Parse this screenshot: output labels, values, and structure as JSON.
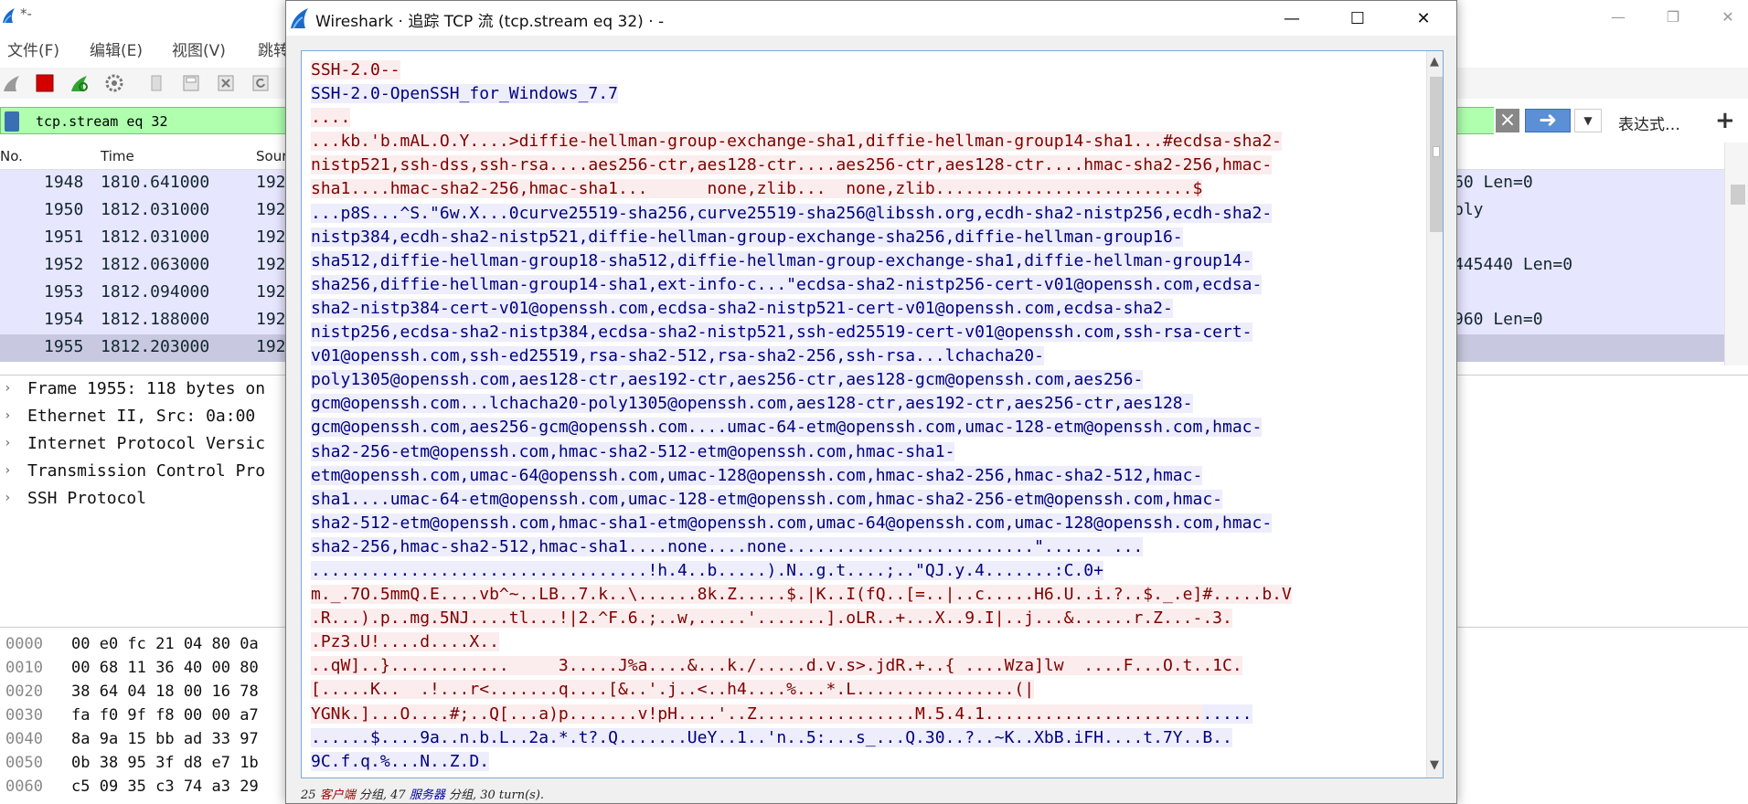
{
  "main_window": {
    "title": "*-",
    "menu": [
      "文件(F)",
      "编辑(E)",
      "视图(V)",
      "跳转"
    ],
    "filter": {
      "text": "tcp.stream eq 32",
      "expression_label": "表达式…",
      "plus": "+"
    },
    "packet_list": {
      "headers": [
        "No.",
        "Time",
        "Sour"
      ],
      "rows": [
        {
          "no": "1948",
          "time": "1810.641000",
          "src": "192",
          "info": "60 Len=0"
        },
        {
          "no": "1950",
          "time": "1812.031000",
          "src": "192",
          "info": "ply"
        },
        {
          "no": "1951",
          "time": "1812.031000",
          "src": "192",
          "info": ""
        },
        {
          "no": "1952",
          "time": "1812.063000",
          "src": "192",
          "info": "445440 Len=0"
        },
        {
          "no": "1953",
          "time": "1812.094000",
          "src": "192",
          "info": ""
        },
        {
          "no": "1954",
          "time": "1812.188000",
          "src": "192",
          "info": "960 Len=0"
        },
        {
          "no": "1955",
          "time": "1812.203000",
          "src": "192",
          "info": ""
        }
      ]
    },
    "details": [
      "Frame 1955: 118 bytes on",
      "Ethernet II, Src: 0a:00",
      "Internet Protocol Versic",
      "Transmission Control Pro",
      "SSH Protocol"
    ],
    "bytes": [
      {
        "offset": "0000",
        "hex": "00 e0 fc 21 04 80 0a"
      },
      {
        "offset": "0010",
        "hex": "00 68 11 36 40 00 80"
      },
      {
        "offset": "0020",
        "hex": "38 64 04 18 00 16 78"
      },
      {
        "offset": "0030",
        "hex": "fa f0 9f f8 00 00 a7"
      },
      {
        "offset": "0040",
        "hex": "8a 9a 15 bb ad 33 97"
      },
      {
        "offset": "0050",
        "hex": "0b 38 95 3f d8 e7 1b"
      },
      {
        "offset": "0060",
        "hex": "c5 09 35 c3 74 a3 29"
      }
    ]
  },
  "dialog": {
    "title": "Wireshark · 追踪 TCP 流 (tcp.stream eq 32) · -",
    "status": {
      "client_count": "25",
      "client_label": "客户端",
      "packets_word": "分组,",
      "server_count": "47",
      "server_label": "服务器",
      "turns": "30 turn(s)."
    },
    "stream_lines": [
      {
        "dir": "c",
        "text": "SSH-2.0--"
      },
      {
        "dir": "s",
        "text": "SSH-2.0-OpenSSH_for_Windows_7.7"
      },
      {
        "dir": "c",
        "text": "...."
      },
      {
        "dir": "c",
        "text": "...kb.'b.mAL.O.Y....>diffie-hellman-group-exchange-sha1,diffie-hellman-group14-sha1...#ecdsa-sha2-"
      },
      {
        "dir": "c",
        "text": "nistp521,ssh-dss,ssh-rsa....aes256-ctr,aes128-ctr....aes256-ctr,aes128-ctr....hmac-sha2-256,hmac-"
      },
      {
        "dir": "c",
        "text": "sha1....hmac-sha2-256,hmac-sha1...      none,zlib...  none,zlib..........................$"
      },
      {
        "dir": "s",
        "text": "...p8S...^S.\"6w.X...0curve25519-sha256,curve25519-sha256@libssh.org,ecdh-sha2-nistp256,ecdh-sha2-"
      },
      {
        "dir": "s",
        "text": "nistp384,ecdh-sha2-nistp521,diffie-hellman-group-exchange-sha256,diffie-hellman-group16-"
      },
      {
        "dir": "s",
        "text": "sha512,diffie-hellman-group18-sha512,diffie-hellman-group-exchange-sha1,diffie-hellman-group14-"
      },
      {
        "dir": "s",
        "text": "sha256,diffie-hellman-group14-sha1,ext-info-c...\"ecdsa-sha2-nistp256-cert-v01@openssh.com,ecdsa-"
      },
      {
        "dir": "s",
        "text": "sha2-nistp384-cert-v01@openssh.com,ecdsa-sha2-nistp521-cert-v01@openssh.com,ecdsa-sha2-"
      },
      {
        "dir": "s",
        "text": "nistp256,ecdsa-sha2-nistp384,ecdsa-sha2-nistp521,ssh-ed25519-cert-v01@openssh.com,ssh-rsa-cert-"
      },
      {
        "dir": "s",
        "text": "v01@openssh.com,ssh-ed25519,rsa-sha2-512,rsa-sha2-256,ssh-rsa...lchacha20-"
      },
      {
        "dir": "s",
        "text": "poly1305@openssh.com,aes128-ctr,aes192-ctr,aes256-ctr,aes128-gcm@openssh.com,aes256-"
      },
      {
        "dir": "s",
        "text": "gcm@openssh.com...lchacha20-poly1305@openssh.com,aes128-ctr,aes192-ctr,aes256-ctr,aes128-"
      },
      {
        "dir": "s",
        "text": "gcm@openssh.com,aes256-gcm@openssh.com....umac-64-etm@openssh.com,umac-128-etm@openssh.com,hmac-"
      },
      {
        "dir": "s",
        "text": "sha2-256-etm@openssh.com,hmac-sha2-512-etm@openssh.com,hmac-sha1-"
      },
      {
        "dir": "s",
        "text": "etm@openssh.com,umac-64@openssh.com,umac-128@openssh.com,hmac-sha2-256,hmac-sha2-512,hmac-"
      },
      {
        "dir": "s",
        "text": "sha1....umac-64-etm@openssh.com,umac-128-etm@openssh.com,hmac-sha2-256-etm@openssh.com,hmac-"
      },
      {
        "dir": "s",
        "text": "sha2-512-etm@openssh.com,hmac-sha1-etm@openssh.com,umac-64@openssh.com,umac-128@openssh.com,hmac-"
      },
      {
        "dir": "s",
        "text": "sha2-256,hmac-sha2-512,hmac-sha1....none....none.........................\"...... ..."
      },
      {
        "dir": "s",
        "text": "..................................!h.4..b.....).N..g.t....;..\"QJ.y.4.......:C.0+"
      },
      {
        "dir": "c",
        "text": "m._.7O.5mmQ.E....vb^~..LB..7.k..\\......8k.Z.....$.|K..I(fQ..[=..|..c.....H6.U..i.?..$._.e]#.....b.V"
      },
      {
        "dir": "c",
        "text": ".R...).p..mg.5NJ....tl...!|2.^F.6.;..w,.....'.......].oLR..+...X..9.I|..j...&......r.Z...-.3."
      },
      {
        "dir": "c",
        "text": ".Pz3.U!....d....X.."
      },
      {
        "dir": "c",
        "text": "..qW]..}............     3.....J%a....&...k./.....d.v.s>.jdR.+..{ ....Wza]lw  ....F...O.t..1C."
      },
      {
        "dir": "c",
        "text": "[.....K..  .!...r<.......q....[&..'.j..<..h4....%...*.L................(|"
      },
      {
        "dir": "c",
        "text": "YGNk.]...O....#;..Q[...a)p.......v!pH....'..Z................M.5.4.1......................",
        "tail": "....."
      },
      {
        "dir": "s",
        "text": "......$....9a..n.b.L..2a.*.t?.Q.......UeY..1..'n..5:...s_...Q.30..?..~K..XbB.iFH....t.7Y..B.."
      },
      {
        "dir": "s",
        "text": "9C.f.q.%...N..Z.D."
      }
    ]
  },
  "colors": {
    "client_text": "#7f0000",
    "client_bg": "#fbeded",
    "server_text": "#00007f",
    "server_bg": "#ededfb",
    "filter_bg": "#afffaf",
    "row_bg": "#e7e6ff"
  }
}
